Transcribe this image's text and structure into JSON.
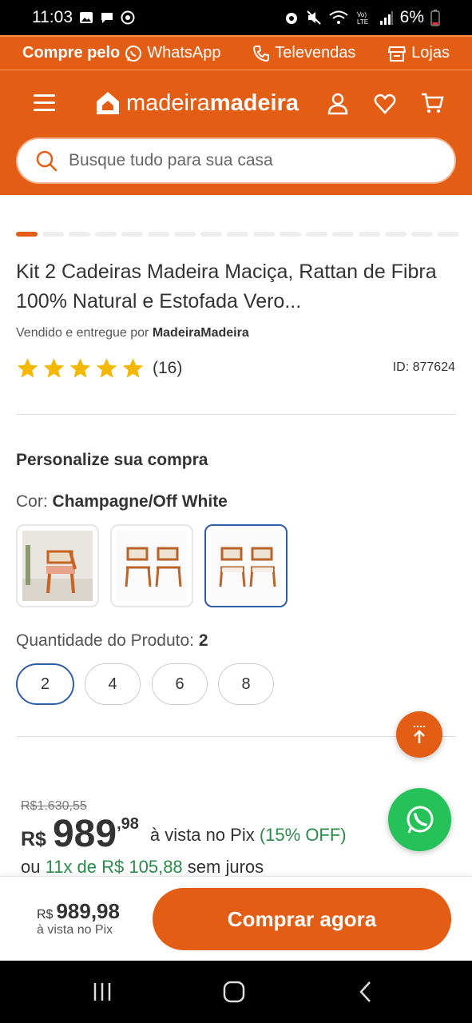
{
  "status_bar": {
    "time": "11:03",
    "battery": "6%"
  },
  "contact_bar": {
    "prefix": "Compre pelo",
    "whatsapp": "WhatsApp",
    "televendas": "Televendas",
    "lojas": "Lojas"
  },
  "header": {
    "logo_part1": "madeira",
    "logo_part2": "madeira",
    "search_placeholder": "Busque tudo para sua casa"
  },
  "carousel": {
    "total_slides": 17,
    "active_index": 0
  },
  "product": {
    "title": "Kit 2 Cadeiras Madeira Maciça, Rattan de Fibra 100% Natural e Estofada Vero...",
    "sold_by_prefix": "Vendido e entregue por",
    "seller": "MadeiraMadeira",
    "rating_stars": 5,
    "review_count": "(16)",
    "id_label": "ID: 877624"
  },
  "customize": {
    "heading": "Personalize sua compra",
    "color_label": "Cor:",
    "color_value": "Champagne/Off White",
    "swatches": [
      {
        "name": "chair-lifestyle-photo",
        "selected": false
      },
      {
        "name": "two-chairs-photo",
        "selected": false
      },
      {
        "name": "two-chairs-photo-alt",
        "selected": true
      }
    ],
    "quantity_label": "Quantidade do Produto:",
    "quantity_value": "2",
    "quantity_options": [
      "2",
      "4",
      "6",
      "8"
    ],
    "selected_quantity": "2"
  },
  "pricing": {
    "old_price": "R$1.630,55",
    "currency": "R$",
    "price_whole": "989",
    "price_cents": ",98",
    "pix_text": "à vista no Pix",
    "pix_discount": "(15% OFF)",
    "install_prefix": "ou",
    "install_value": "11x de R$ 105,88",
    "install_suffix": "sem juros"
  },
  "buy_bar": {
    "currency": "R$",
    "price": "989,98",
    "note": "à vista no Pix",
    "button_label": "Comprar agora"
  },
  "colors": {
    "brand_orange": "#e35d14",
    "selected_blue": "#2e5ea8",
    "pix_green": "#2c8a4b",
    "whatsapp_green": "#25c25a",
    "star_yellow": "#f5b800"
  }
}
